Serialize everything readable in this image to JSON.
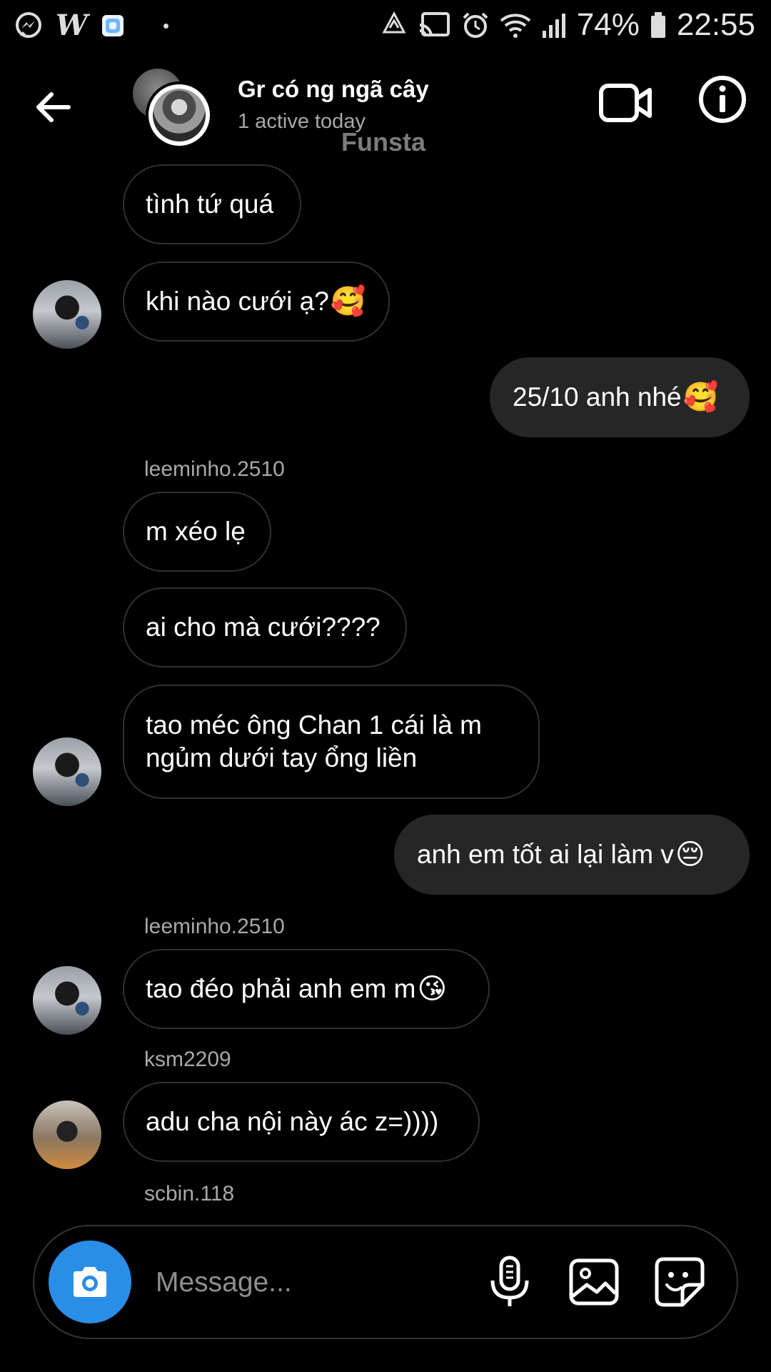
{
  "status_bar": {
    "battery": "74%",
    "time": "22:55",
    "left_icons": [
      "messenger-icon",
      "w-app-icon",
      "app-icon",
      "dot"
    ],
    "right_icons": [
      "recycle-icon",
      "cast-icon",
      "alarm-icon",
      "wifi-icon",
      "signal-icon",
      "battery-icon"
    ]
  },
  "header": {
    "title": "Gr có ng ngã cây",
    "status": "1 active today",
    "watermark": "Funsta"
  },
  "messages": [
    {
      "text": "tình tứ quá",
      "emoji": ""
    },
    {
      "text": "khi nào cưới ạ?",
      "emoji": "🥰"
    },
    {
      "text": "25/10 anh nhé",
      "emoji": "🥰"
    },
    {
      "text": "m xéo lẹ",
      "emoji": ""
    },
    {
      "text": "ai cho mà cưới????",
      "emoji": ""
    },
    {
      "text": "tao méc ông Chan 1 cái là m ngủm dưới tay ổng liền",
      "emoji": ""
    },
    {
      "text": "anh em tốt ai lại làm v",
      "emoji": "😔"
    },
    {
      "text": "tao đéo phải anh em m",
      "emoji": "😘"
    },
    {
      "text": "adu cha nội này ác z=))))",
      "emoji": ""
    }
  ],
  "senders": [
    "leeminho.2510",
    "leeminho.2510",
    "ksm2209",
    "scbin.118"
  ],
  "composer": {
    "placeholder": "Message..."
  },
  "colors": {
    "background": "#000000",
    "my_bubble": "#262626",
    "camera_button": "#2a8ee6",
    "secondary_text": "#a8a8a8"
  }
}
